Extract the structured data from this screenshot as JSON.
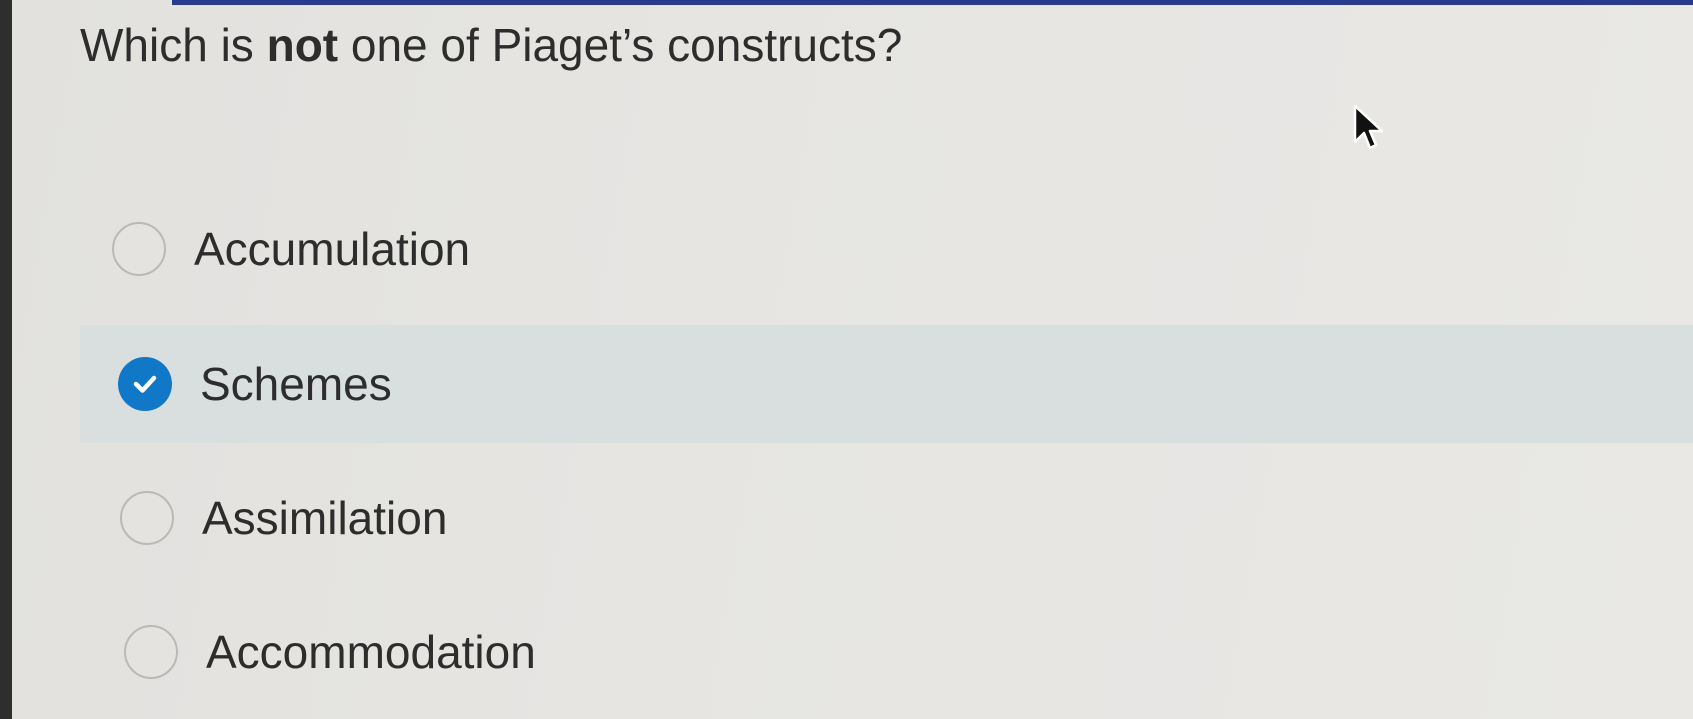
{
  "question": {
    "prefix": "Which is ",
    "emphasis": "not",
    "suffix": " one of Piaget’s constructs?"
  },
  "options": [
    {
      "label": "Accumulation",
      "selected": false
    },
    {
      "label": "Schemes",
      "selected": true
    },
    {
      "label": "Assimilation",
      "selected": false
    },
    {
      "label": "Accommodation",
      "selected": false
    }
  ],
  "colors": {
    "accent": "#1178c8",
    "selected_row": "#d9dedf",
    "top_bar": "#2a3a8f"
  }
}
